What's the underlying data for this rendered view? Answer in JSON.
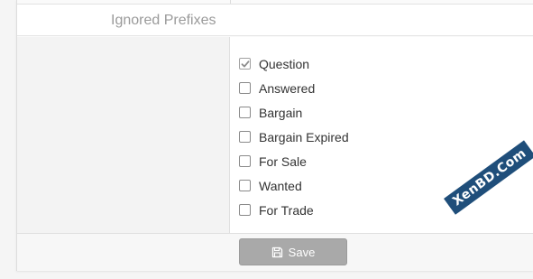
{
  "section": {
    "title": "Ignored Prefixes"
  },
  "prefixes": [
    {
      "label": "Question",
      "checked": true
    },
    {
      "label": "Answered",
      "checked": false
    },
    {
      "label": "Bargain",
      "checked": false
    },
    {
      "label": "Bargain Expired",
      "checked": false
    },
    {
      "label": "For Sale",
      "checked": false
    },
    {
      "label": "Wanted",
      "checked": false
    },
    {
      "label": "For Trade",
      "checked": false
    }
  ],
  "footer": {
    "save_label": "Save",
    "save_icon": "floppy-disk-icon"
  },
  "watermark": {
    "text": "XenBD.Com"
  }
}
